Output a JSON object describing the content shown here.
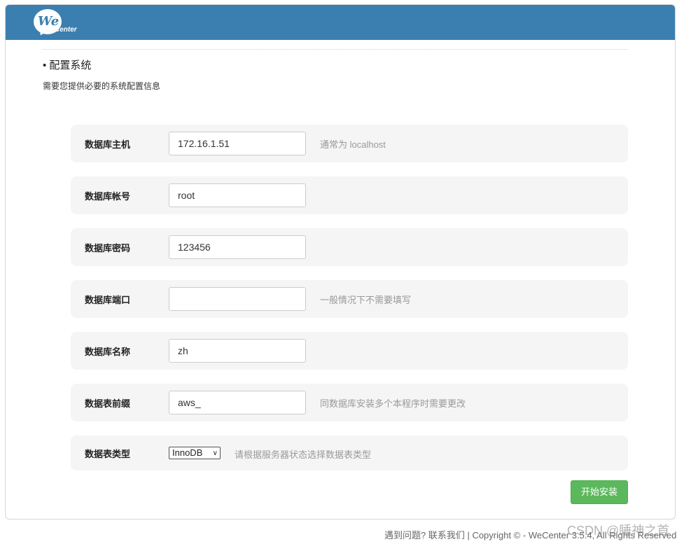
{
  "header": {
    "logo_text_main": "We",
    "logo_text_sub": "Center",
    "bar_color": "#3b7fb0"
  },
  "section": {
    "title": "• 配置系统",
    "description": "需要您提供必要的系统配置信息"
  },
  "form": {
    "rows": [
      {
        "label": "数据库主机",
        "value": "172.16.1.51",
        "hint": "通常为 localhost"
      },
      {
        "label": "数据库帐号",
        "value": "root",
        "hint": ""
      },
      {
        "label": "数据库密码",
        "value": "123456",
        "hint": ""
      },
      {
        "label": "数据库端口",
        "value": "",
        "hint": "一般情况下不需要填写"
      },
      {
        "label": "数据库名称",
        "value": "zh",
        "hint": ""
      },
      {
        "label": "数据表前缀",
        "value": "aws_",
        "hint": "同数据库安装多个本程序时需要更改"
      }
    ],
    "engine": {
      "label": "数据表类型",
      "selected": "InnoDB",
      "hint": "请根据服务器状态选择数据表类型"
    }
  },
  "actions": {
    "install_label": "开始安装",
    "install_color": "#5cb85c"
  },
  "footer": {
    "text": "遇到问题? 联系我们 | Copyright © - WeCenter 3.5.4, All Rights Reserved"
  },
  "watermark": {
    "text": "CSDN @睡神之首"
  }
}
